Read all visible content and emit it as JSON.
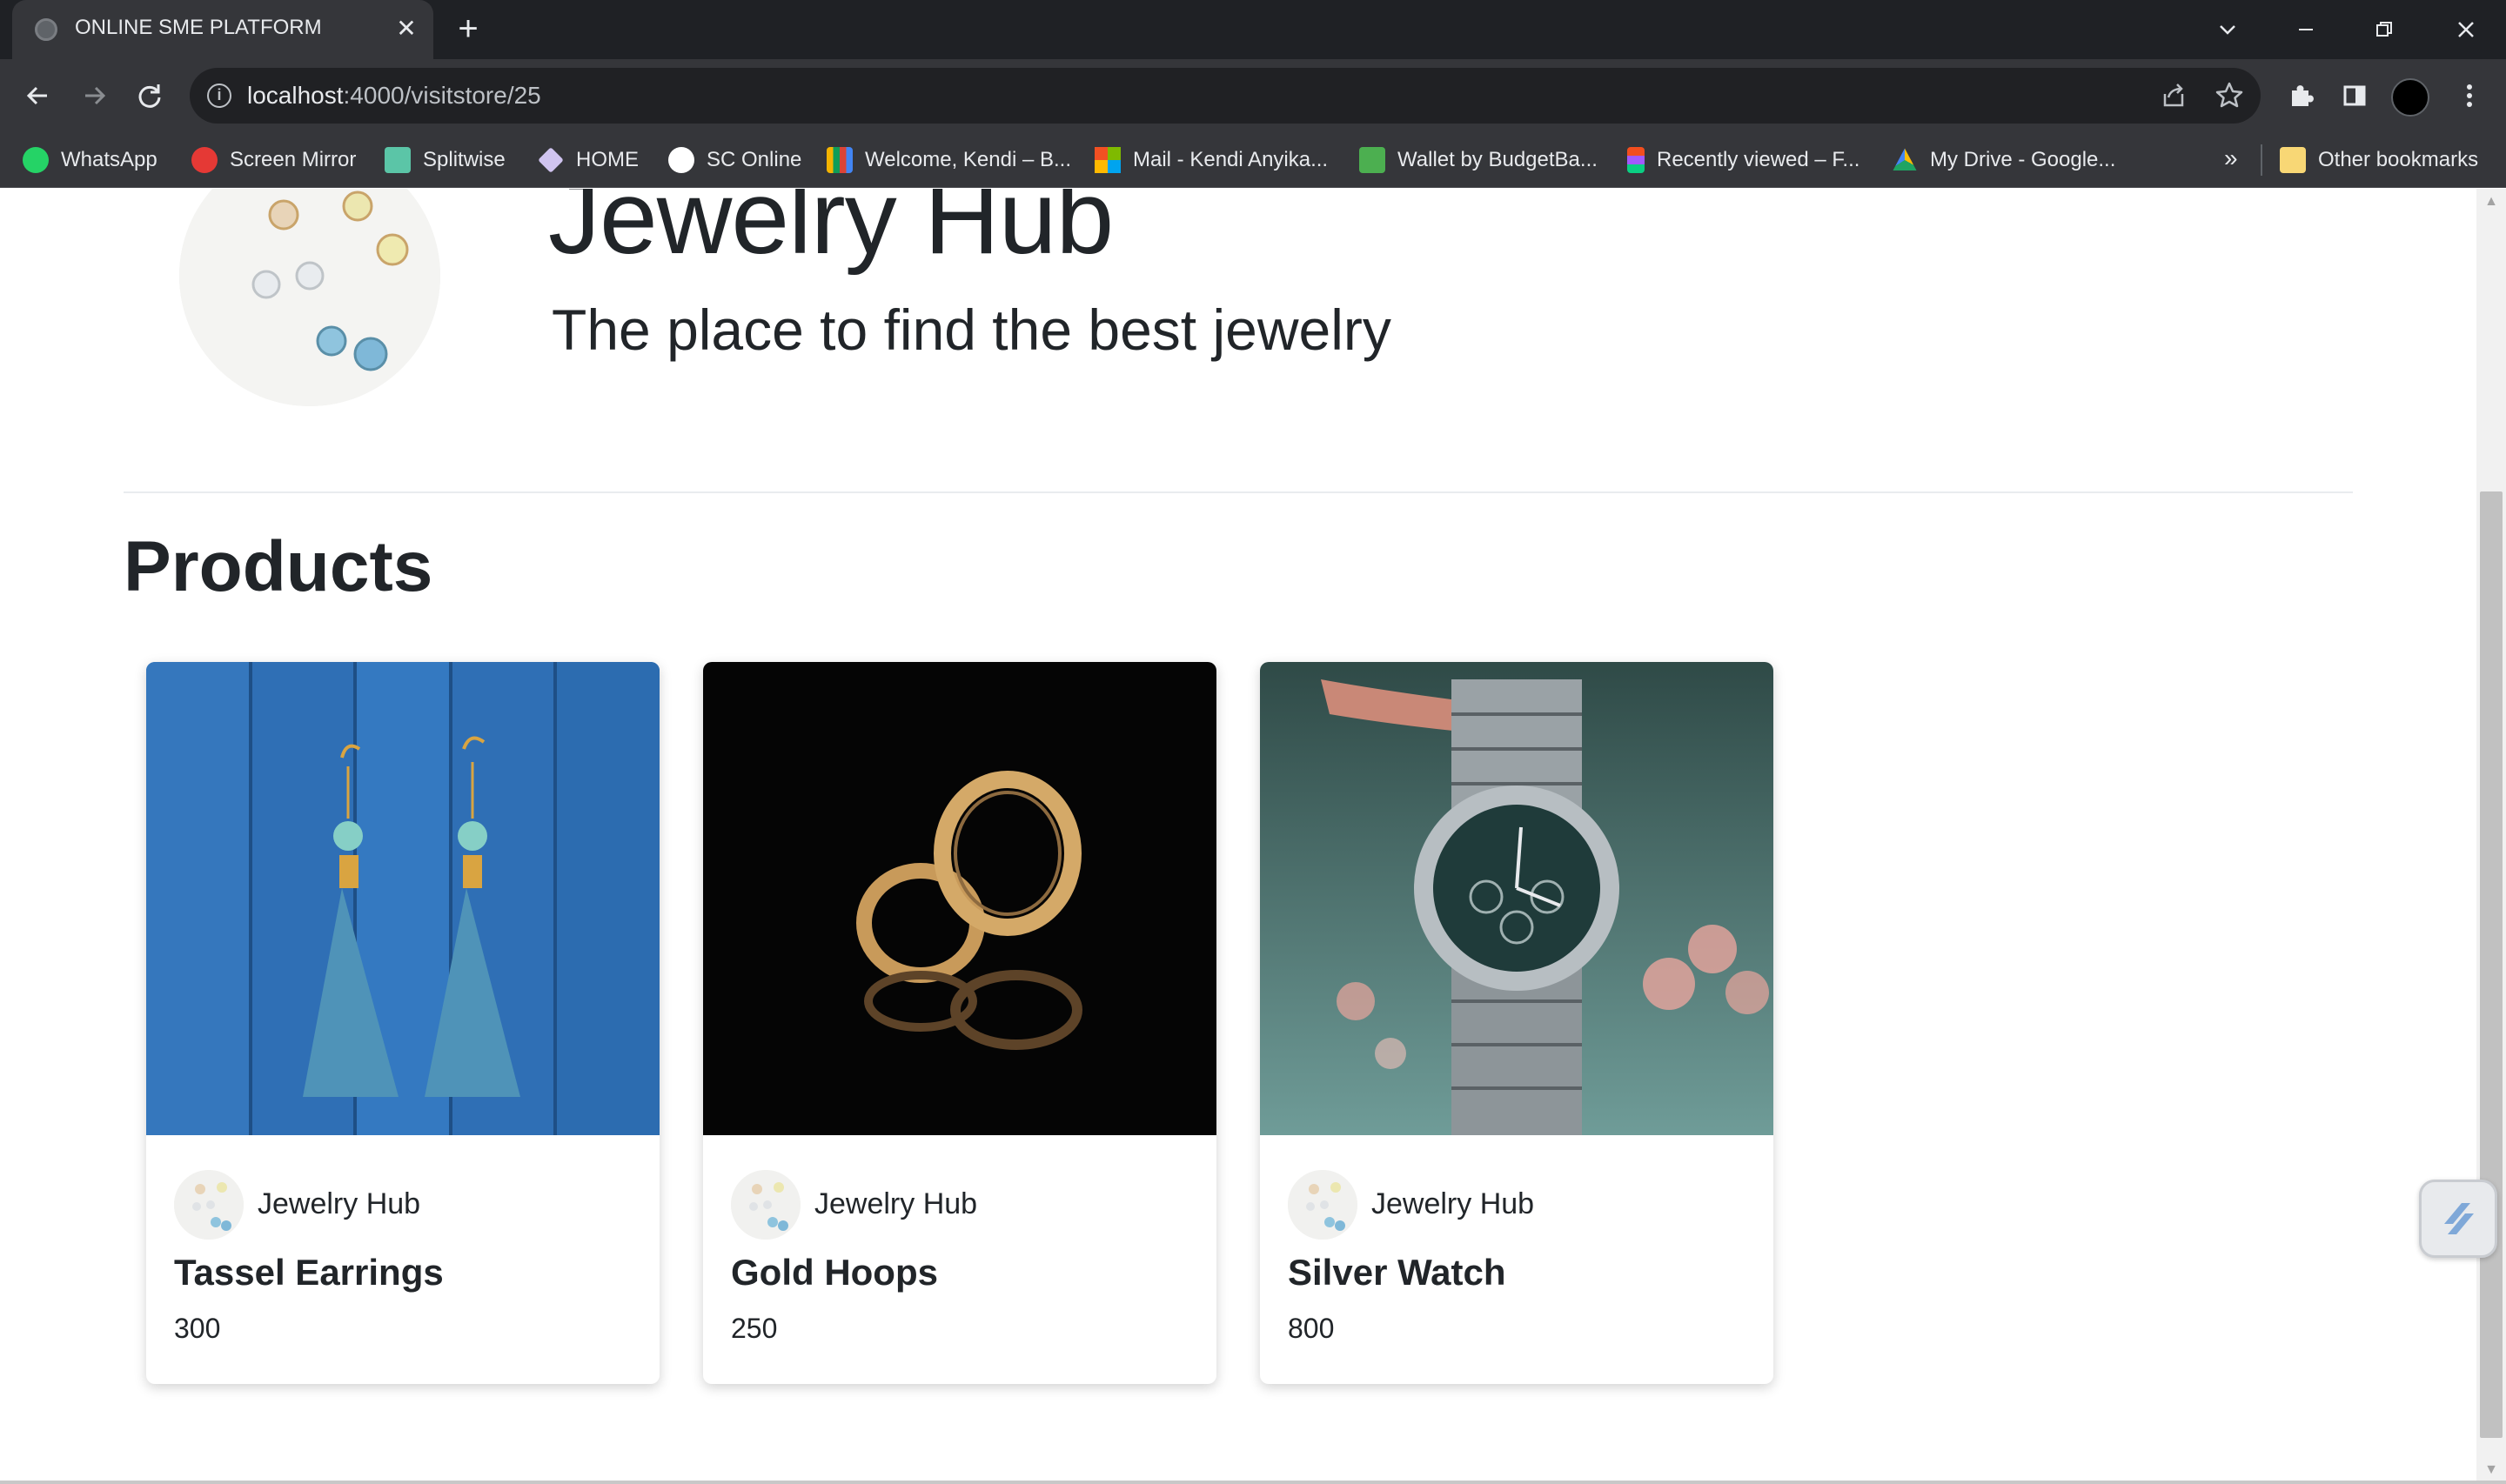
{
  "browser": {
    "tab_title": "ONLINE SME PLATFORM",
    "url_host": "localhost",
    "url_path": ":4000/visitstore/25",
    "bookmarks": [
      {
        "label": "WhatsApp",
        "color": "#25d366"
      },
      {
        "label": "Screen Mirror",
        "color": "#e53935"
      },
      {
        "label": "Splitwise",
        "color": "#5bc5a7"
      },
      {
        "label": "HOME",
        "color": "#d0c4f0"
      },
      {
        "label": "SC Online",
        "color": "#ffffff"
      },
      {
        "label": "Welcome, Kendi – B...",
        "color": "#f4b400"
      },
      {
        "label": "Mail - Kendi Anyika...",
        "color": "#0078d4"
      },
      {
        "label": "Wallet by BudgetBa...",
        "color": "#4caf50"
      },
      {
        "label": "Recently viewed – F...",
        "color": "#f24e1e"
      },
      {
        "label": "My Drive - Google...",
        "color": "#1fa463"
      }
    ],
    "more_bookmarks": "»",
    "other_bookmarks": "Other bookmarks"
  },
  "store": {
    "name": "Jewelry Hub",
    "tagline": "The place to find the best jewelry"
  },
  "products_section": {
    "title": "Products",
    "items": [
      {
        "name": "Tassel Earrings",
        "seller": "Jewelry Hub",
        "price": "300"
      },
      {
        "name": "Gold Hoops",
        "seller": "Jewelry Hub",
        "price": "250"
      },
      {
        "name": "Silver Watch",
        "seller": "Jewelry Hub",
        "price": "800"
      }
    ]
  },
  "icons": {
    "back": "arrow-left-icon",
    "forward": "arrow-right-icon",
    "reload": "reload-icon",
    "info": "info-icon",
    "share": "share-icon",
    "star": "star-icon",
    "extensions": "puzzle-icon",
    "side_panel": "side-panel-icon"
  },
  "colors": {
    "chrome_dark": "#1f2125",
    "toolbar": "#35363a",
    "text_dark": "#212529"
  }
}
